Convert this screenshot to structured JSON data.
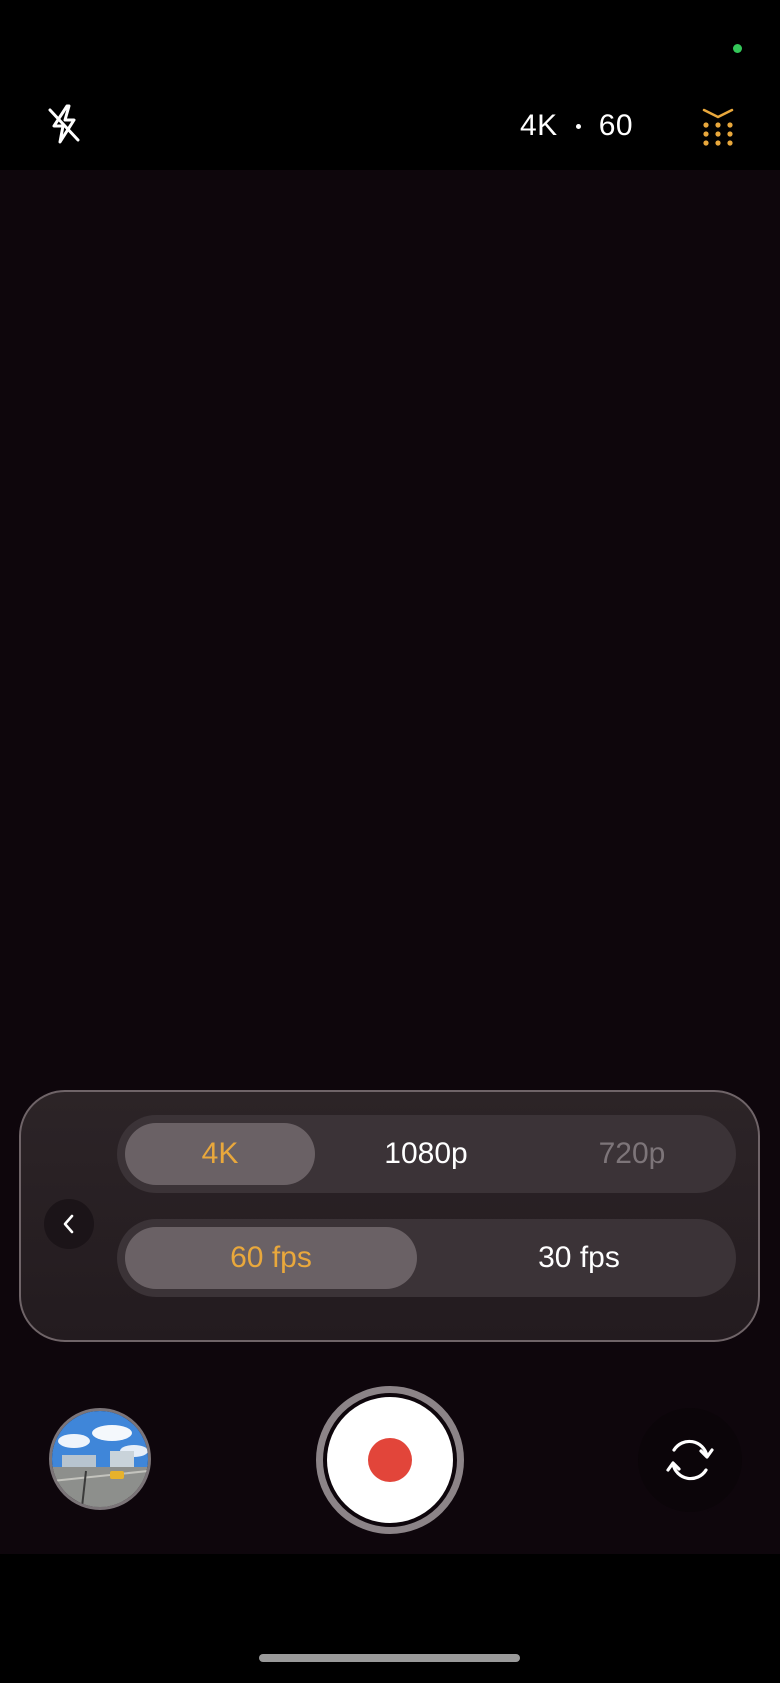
{
  "colors": {
    "accent": "#e9a83c",
    "record": "#e2453a",
    "status_dot": "#34c759",
    "viewfinder": "#0e060c"
  },
  "icons": {
    "flash": "flash-off-icon",
    "grid": "settings-grid-icon",
    "back": "chevron-left-icon",
    "switch": "camera-switch-icon",
    "record": "record-icon"
  },
  "topbar": {
    "resolution": "4K",
    "fps": "60"
  },
  "format_panel": {
    "resolution_options": [
      {
        "label": "4K",
        "state": "selected"
      },
      {
        "label": "1080p",
        "state": "normal"
      },
      {
        "label": "720p",
        "state": "disabled"
      }
    ],
    "fps_options": [
      {
        "label": "60 fps",
        "state": "selected"
      },
      {
        "label": "30 fps",
        "state": "normal"
      }
    ]
  }
}
